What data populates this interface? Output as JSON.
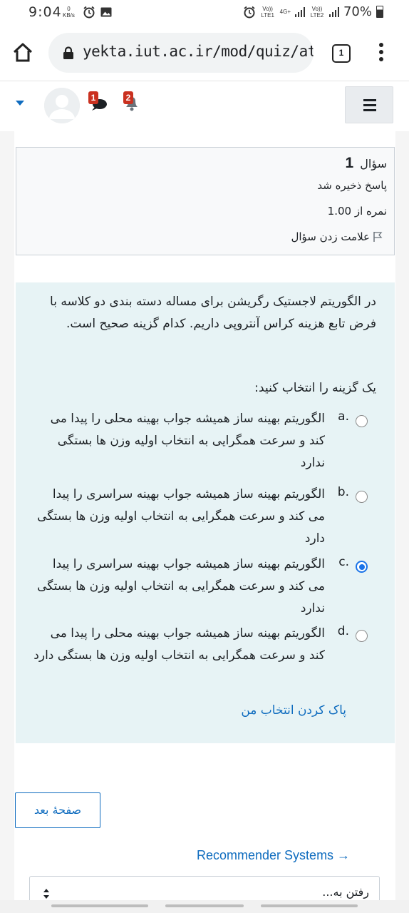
{
  "status_bar": {
    "time": "9:04",
    "kbs_value": "0",
    "kbs_unit": "KB/s",
    "sim1": "Vo)) LTE1",
    "net": "4G+",
    "sim2": "Vo)) LTE2",
    "battery": "70%"
  },
  "browser": {
    "url": "yekta.iut.ac.ir/mod/quiz/atte",
    "tab_count": "1"
  },
  "navbar": {
    "message_count": "1",
    "notification_count": "2",
    "accent_color": "#0f6cbf"
  },
  "question_info": {
    "label": "سؤال",
    "number": "1",
    "state": "پاسخ ذخیره شد",
    "grade": "نمره از 1.00",
    "flag": "علامت زدن سؤال"
  },
  "question": {
    "text": "در الگوریتم لاجستیک رگریشن برای مساله دسته بندی دو کلاسه با فرض تابع هزینه کراس آنتروپی داریم. کدام گزینه صحیح است.",
    "prompt": "یک گزینه را انتخاب کنید:",
    "answers": [
      {
        "letter": "a.",
        "text": "الگوریتم بهینه ساز همیشه جواب بهینه محلی را پیدا می کند و سرعت همگرایی به انتخاب اولیه وزن ها بستگی ندارد",
        "selected": false
      },
      {
        "letter": "b.",
        "text": "الگوریتم بهینه ساز همیشه جواب بهینه سراسری را پیدا می کند و سرعت همگرایی به انتخاب اولیه وزن ها بستگی دارد",
        "selected": false
      },
      {
        "letter": "c.",
        "text": "الگوریتم بهینه ساز همیشه جواب بهینه سراسری را پیدا می کند و سرعت همگرایی به انتخاب اولیه وزن ها بستگی ندارد",
        "selected": true
      },
      {
        "letter": "d.",
        "text": "الگوریتم بهینه ساز همیشه جواب بهینه محلی را پیدا می کند و سرعت همگرایی به انتخاب اولیه وزن ها بستگی دارد",
        "selected": false
      }
    ],
    "clear_choice": "پاک کردن انتخاب من"
  },
  "footer": {
    "next_page": "صفحهٔ بعد",
    "activity_link": "Recommender Systems →",
    "jump_to": "رفتن به..."
  }
}
